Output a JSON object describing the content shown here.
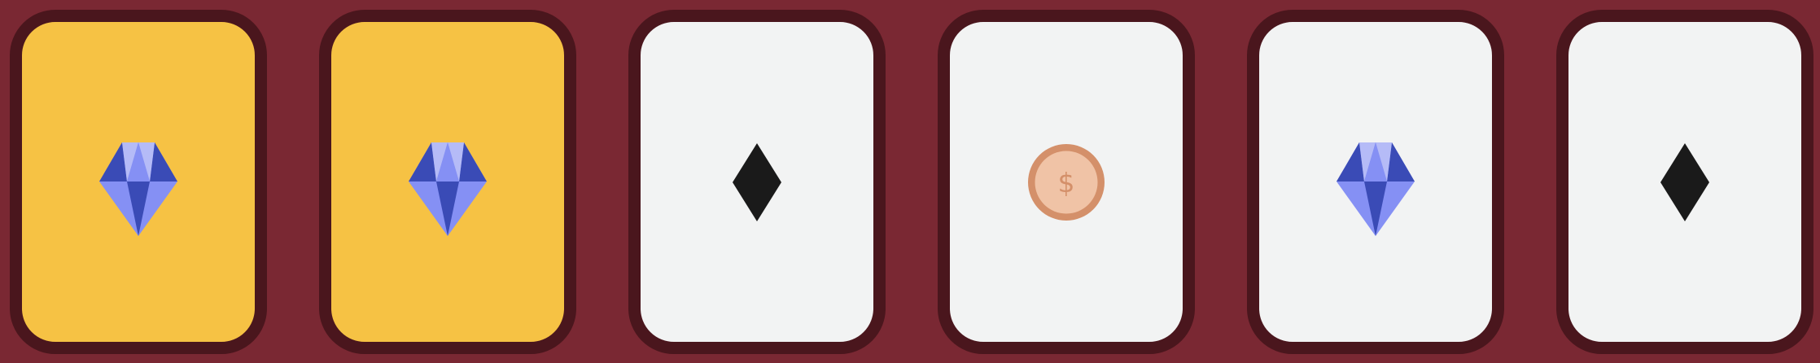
{
  "game": {
    "cards": [
      {
        "symbol": "gem-icon",
        "face": "gold"
      },
      {
        "symbol": "gem-icon",
        "face": "gold"
      },
      {
        "symbol": "diamond-suit-icon",
        "face": "white"
      },
      {
        "symbol": "coin-icon",
        "face": "white"
      },
      {
        "symbol": "gem-icon",
        "face": "white"
      },
      {
        "symbol": "diamond-suit-icon",
        "face": "white"
      }
    ],
    "colors": {
      "background": "#7a2833",
      "card_border": "#4a161d",
      "card_gold": "#f6c244",
      "card_white": "#f2f3f3",
      "gem_light": "#8590f4",
      "gem_pale": "#b5bbf7",
      "gem_dark": "#3a4bb6",
      "suit_black": "#1a1a1a",
      "coin_ring": "#d4906a",
      "coin_face": "#f0c3a6"
    },
    "coin": {
      "glyph": "$"
    }
  }
}
